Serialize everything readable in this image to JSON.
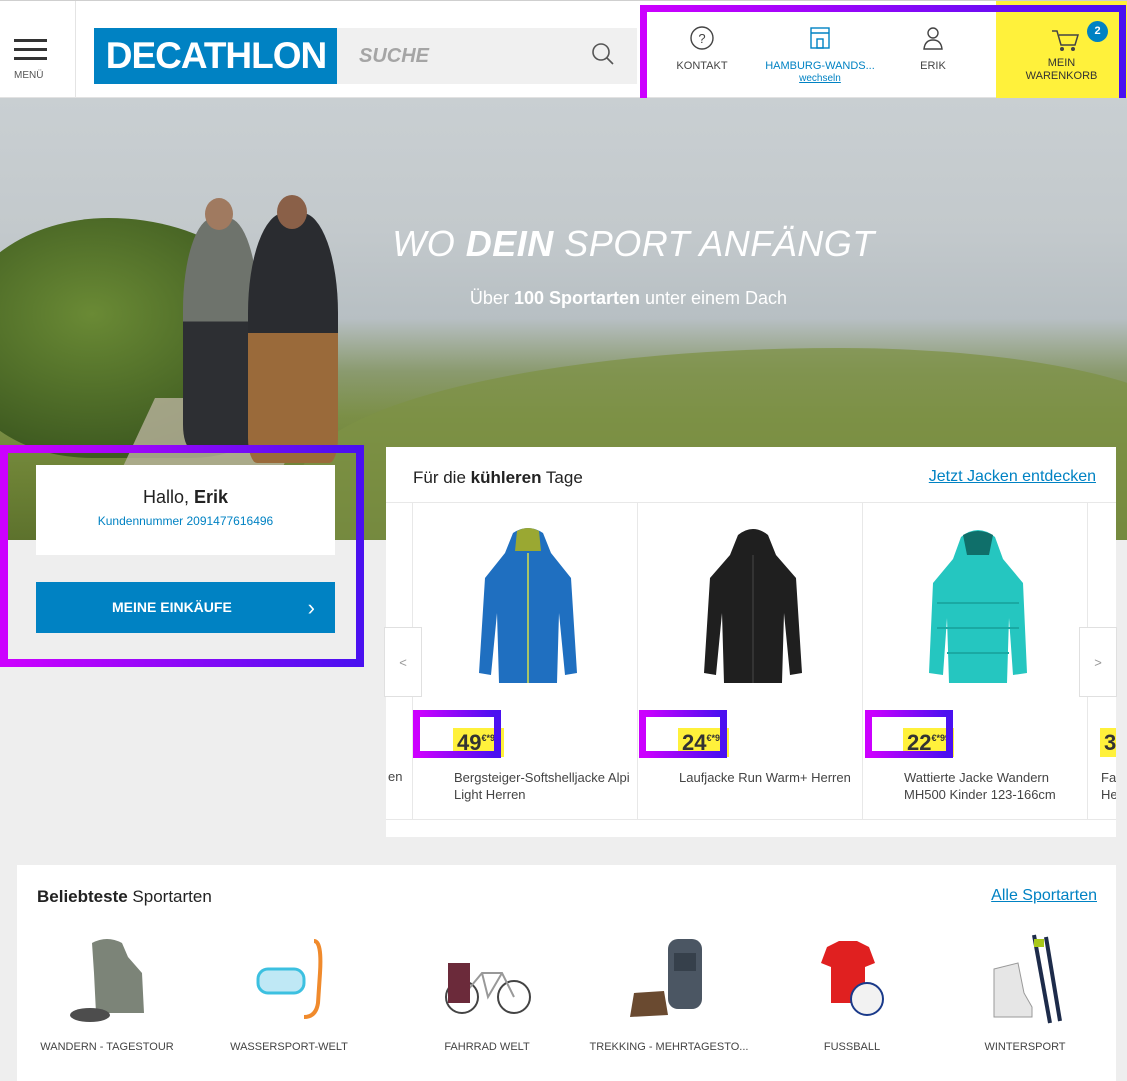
{
  "header": {
    "menu_label": "MENÜ",
    "logo_text": "DECATHLON",
    "search_placeholder": "SUCHE",
    "contact_label": "KONTAKT",
    "store_label": "HAMBURG-WANDS...",
    "store_change": "wechseln",
    "user_label": "ERIK",
    "cart_line1": "MEIN",
    "cart_line2": "WARENKORB",
    "cart_count": "2"
  },
  "hero": {
    "headline_pre": "WO ",
    "headline_bold": "DEIN",
    "headline_post": " SPORT ANFÄNGT",
    "tagline_pre": "Über ",
    "tagline_bold": "100 Sportarten",
    "tagline_post": " unter einem Dach"
  },
  "welcome": {
    "greeting": "Hallo, ",
    "name": "Erik",
    "customer_number": "Kundennummer 2091477616496",
    "button_label": "MEINE EINKÄUFE"
  },
  "carousel": {
    "title_pre": "Für die ",
    "title_bold": "kühleren",
    "title_post": " Tage",
    "link": "Jetzt Jacken entdecken",
    "prev": "<",
    "next": ">",
    "partial_left_text": "en",
    "products": [
      {
        "price_euro": "49",
        "price_cents": "€*99",
        "name": "Bergsteiger-Softshelljacke Alpi Light Herren",
        "color": "#1f6fc0"
      },
      {
        "price_euro": "24",
        "price_cents": "€*99",
        "name": "Laufjacke Run Warm+ Herren",
        "color": "#1f1f1f"
      },
      {
        "price_euro": "22",
        "price_cents": "€*99",
        "name": "Wattierte Jacke Wandern MH500 Kinder 123-166cm",
        "color": "#25c6c0"
      },
      {
        "price_euro": "3",
        "price_cents": "",
        "name": "Fa He",
        "color": "#cccccc"
      }
    ]
  },
  "sports": {
    "title_bold": "Beliebteste",
    "title_post": " Sportarten",
    "link": "Alle Sportarten",
    "items": [
      {
        "name": "WANDERN - TAGESTOUR",
        "icon": "hiking-jacket-icon"
      },
      {
        "name": "WASSERSPORT-WELT",
        "icon": "snorkel-mask-icon"
      },
      {
        "name": "FAHRRAD WELT",
        "icon": "bicycle-icon"
      },
      {
        "name": "TREKKING - MEHRTAGESTO...",
        "icon": "backpack-icon"
      },
      {
        "name": "FUSSBALL",
        "icon": "football-icon"
      },
      {
        "name": "WINTERSPORT",
        "icon": "ski-icon"
      }
    ]
  }
}
